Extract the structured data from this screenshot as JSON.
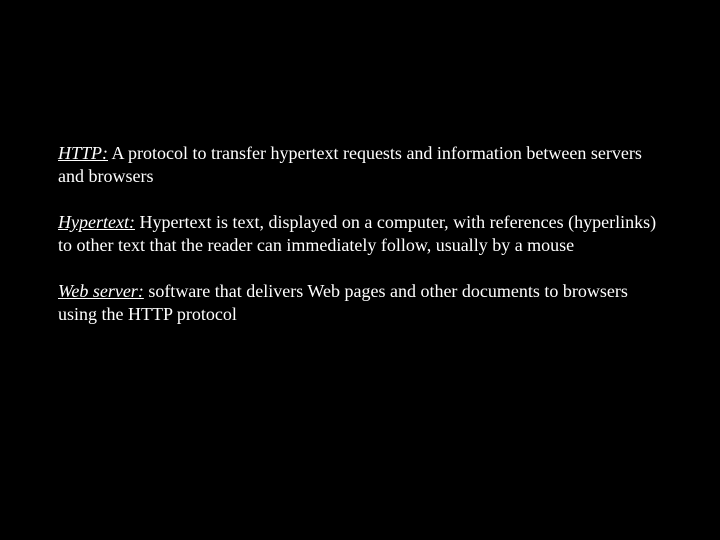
{
  "entries": [
    {
      "term": "HTTP:",
      "definition": " A protocol to transfer hypertext requests and information between servers and browsers"
    },
    {
      "term": "Hypertext:",
      "definition": " Hypertext is text, displayed on a computer, with references (hyperlinks) to other text that the reader can immediately follow, usually by a mouse"
    },
    {
      "term": "Web server:",
      "definition": " software that delivers Web pages and other documents to browsers using the HTTP protocol"
    }
  ]
}
